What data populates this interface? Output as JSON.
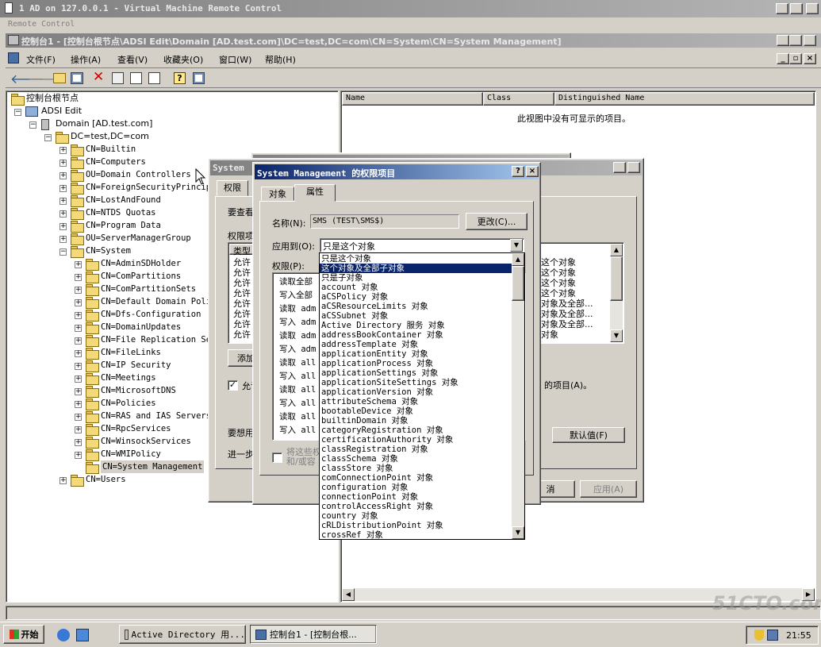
{
  "vm_window": {
    "title": "1 AD on 127.0.0.1 - Virtual Machine Remote Control",
    "menu": "Remote Control"
  },
  "mmc": {
    "title": "控制台1 - [控制台根节点\\ADSI Edit\\Domain [AD.test.com]\\DC=test,DC=com\\CN=System\\CN=System Management]",
    "menus": [
      "文件(F)",
      "操作(A)",
      "查看(V)",
      "收藏夹(O)",
      "窗口(W)",
      "帮助(H)"
    ]
  },
  "tree": {
    "root": "控制台根节点",
    "adsi": "ADSI Edit",
    "domain": "Domain [AD.test.com]",
    "dc": "DC=test,DC=com",
    "level1": [
      "CN=Builtin",
      "CN=Computers",
      "OU=Domain Controllers",
      "CN=ForeignSecurityPrincipals",
      "CN=LostAndFound",
      "CN=NTDS Quotas",
      "CN=Program Data",
      "OU=ServerManagerGroup",
      "CN=System"
    ],
    "system_children": [
      "CN=AdminSDHolder",
      "CN=ComPartitions",
      "CN=ComPartitionSets",
      "CN=Default Domain Policy",
      "CN=Dfs-Configuration",
      "CN=DomainUpdates",
      "CN=File Replication Service",
      "CN=FileLinks",
      "CN=IP Security",
      "CN=Meetings",
      "CN=MicrosoftDNS",
      "CN=Policies",
      "CN=RAS and IAS Servers",
      "CN=RpcServices",
      "CN=WinsockServices",
      "CN=WMIPolicy",
      "CN=System Management"
    ],
    "users": "CN=Users"
  },
  "list_view": {
    "columns": [
      "Name",
      "Class",
      "Distinguished Name"
    ],
    "empty_message": "此视图中没有可显示的项目。"
  },
  "props_dialog": {
    "title": "System",
    "tab": "权限",
    "text_to_view": "要查看",
    "perm_items_label": "权限项",
    "col_type": "类型",
    "type_rows": [
      "允许",
      "允许",
      "允许",
      "允许",
      "允许",
      "允许",
      "允许",
      "允许"
    ],
    "apply_rows": [
      "这个对象",
      "这个对象",
      "这个对象",
      "这个对象",
      "对象及全部...",
      "对象及全部...",
      "对象及全部...",
      "对象"
    ],
    "add_button": "添加",
    "inherit_check": "允许",
    "inherit_text": "的项目(A)。",
    "special_text": "要想用",
    "advanced_text": "进一步",
    "default_button": "默认值(F)",
    "cancel_button": "消",
    "apply_button": "应用(A)"
  },
  "entry_dialog": {
    "title": "System Management 的权限项目",
    "tab_object": "对象",
    "tab_props": "属性",
    "name_label": "名称(N):",
    "name_value": "SMS (TEST\\SMS$)",
    "change_button": "更改(C)...",
    "apply_to_label": "应用到(O):",
    "apply_to_value": "只是这个对象",
    "perms_label": "权限(P):",
    "perm_rows": [
      "读取全部",
      "写入全部",
      "读取 adm",
      "写入 adm",
      "读取 adm",
      "写入 adm",
      "读取 all",
      "写入 all",
      "读取 all",
      "写入 all",
      "读取 all",
      "写入 all"
    ],
    "bottom_check": "将这些权限",
    "bottom_check2": "和/或容"
  },
  "dropdown_options": [
    "只是这个对象",
    "这个对象及全部子对象",
    "只是子对象",
    "account 对象",
    "aCSPolicy 对象",
    "aCSResourceLimits 对象",
    "aCSSubnet 对象",
    "Active Directory 服务 对象",
    "addressBookContainer 对象",
    "addressTemplate 对象",
    "applicationEntity 对象",
    "applicationProcess 对象",
    "applicationSettings 对象",
    "applicationSiteSettings 对象",
    "applicationVersion 对象",
    "attributeSchema 对象",
    "bootableDevice 对象",
    "builtinDomain 对象",
    "categoryRegistration 对象",
    "certificationAuthority 对象",
    "classRegistration 对象",
    "classSchema 对象",
    "classStore 对象",
    "comConnectionPoint 对象",
    "configuration 对象",
    "connectionPoint 对象",
    "controlAccessRight 对象",
    "country 对象",
    "cRLDistributionPoint 对象",
    "crossRef 对象"
  ],
  "dropdown_selected_index": 1,
  "taskbar": {
    "start": "开始",
    "task1": "Active Directory 用...",
    "task2": "控制台1 - [控制台根...",
    "clock": "21:55"
  },
  "watermark": "51CTO.com"
}
